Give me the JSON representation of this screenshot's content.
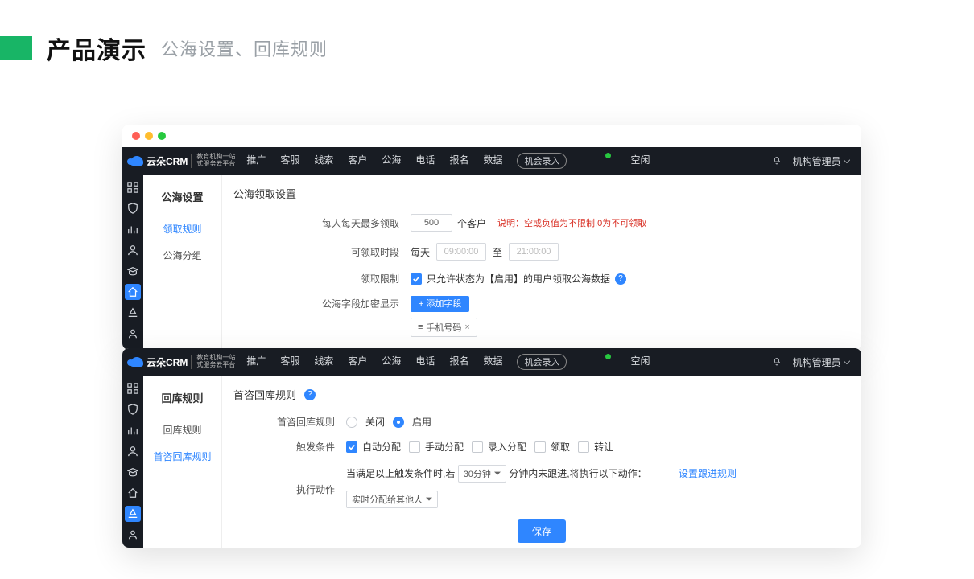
{
  "header": {
    "title": "产品演示",
    "subtitle": "公海设置、回库规则"
  },
  "brand": {
    "name": "云朵CRM",
    "sub1": "教育机构一站",
    "sub2": "式服务云平台"
  },
  "nav": {
    "items": [
      "推广",
      "客服",
      "线索",
      "客户",
      "公海",
      "电话",
      "报名",
      "数据"
    ],
    "action_btn": "机会录入",
    "idle_label": "空闲",
    "user_label": "机构管理员"
  },
  "win1": {
    "side_title": "公海设置",
    "side_items": [
      {
        "label": "领取规则",
        "active": true
      },
      {
        "label": "公海分组",
        "active": false
      }
    ],
    "section_title": "公海领取设置",
    "row_daily": {
      "label": "每人每天最多领取",
      "value": "500",
      "unit": "个客户",
      "note_prefix": "说明：",
      "note": "空或负值为不限制,0为不可领取"
    },
    "row_period": {
      "label": "可领取时段",
      "daily": "每天",
      "from": "09:00:00",
      "to_label": "至",
      "to": "21:00:00"
    },
    "row_limit": {
      "label": "领取限制",
      "text": "只允许状态为【启用】的用户领取公海数据"
    },
    "row_encrypt": {
      "label": "公海字段加密显示",
      "add_btn": "+ 添加字段",
      "tag_icon": "≡",
      "tag": "手机号码",
      "tag_close": "×"
    }
  },
  "win2": {
    "side_title": "回库规则",
    "side_items": [
      {
        "label": "回库规则",
        "active": false
      },
      {
        "label": "首咨回库规则",
        "active": true
      }
    ],
    "section_title": "首咨回库规则",
    "row_rule": {
      "label": "首咨回库规则",
      "off": "关闭",
      "on": "启用"
    },
    "row_trigger": {
      "label": "触发条件",
      "opts": [
        "自动分配",
        "手动分配",
        "录入分配",
        "领取",
        "转让"
      ]
    },
    "row_exec": {
      "label": "执行动作",
      "prefix": "当满足以上触发条件时,若",
      "sel": "30分钟",
      "suffix": "分钟内未跟进,将执行以下动作：",
      "link": "设置跟进规则",
      "action_sel": "实时分配给其他人"
    },
    "save": "保存"
  }
}
